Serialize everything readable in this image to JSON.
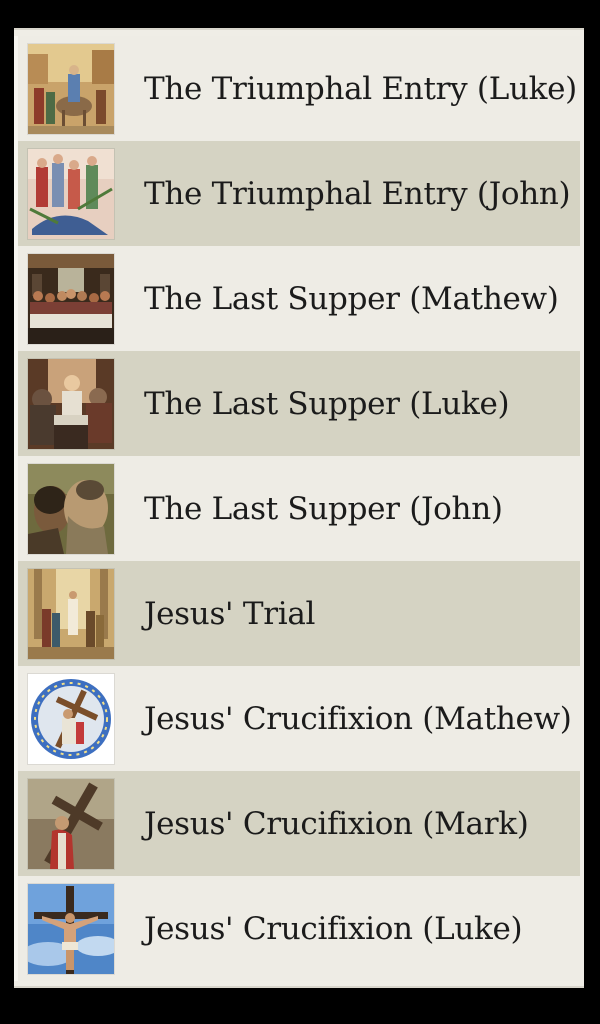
{
  "items": [
    {
      "label": "The Triumphal Entry (Luke)",
      "thumb": "triumphal-entry-painting-icon",
      "shade": "light"
    },
    {
      "label": "The Triumphal Entry (John)",
      "thumb": "palm-crowd-painting-icon",
      "shade": "dark"
    },
    {
      "label": "The Last Supper (Mathew)",
      "thumb": "last-supper-table-painting-icon",
      "shade": "light"
    },
    {
      "label": "The Last Supper (Luke)",
      "thumb": "candlelit-supper-painting-icon",
      "shade": "dark"
    },
    {
      "label": "The Last Supper (John)",
      "thumb": "judas-kiss-painting-icon",
      "shade": "light"
    },
    {
      "label": "Jesus' Trial",
      "thumb": "trial-courtyard-painting-icon",
      "shade": "dark"
    },
    {
      "label": "Jesus' Crucifixion (Mathew)",
      "thumb": "cross-bearing-medallion-icon",
      "shade": "light"
    },
    {
      "label": "Jesus' Crucifixion (Mark)",
      "thumb": "cross-bearing-painting-icon",
      "shade": "dark"
    },
    {
      "label": "Jesus' Crucifixion (Luke)",
      "thumb": "crucifix-sky-painting-icon",
      "shade": "light"
    }
  ]
}
